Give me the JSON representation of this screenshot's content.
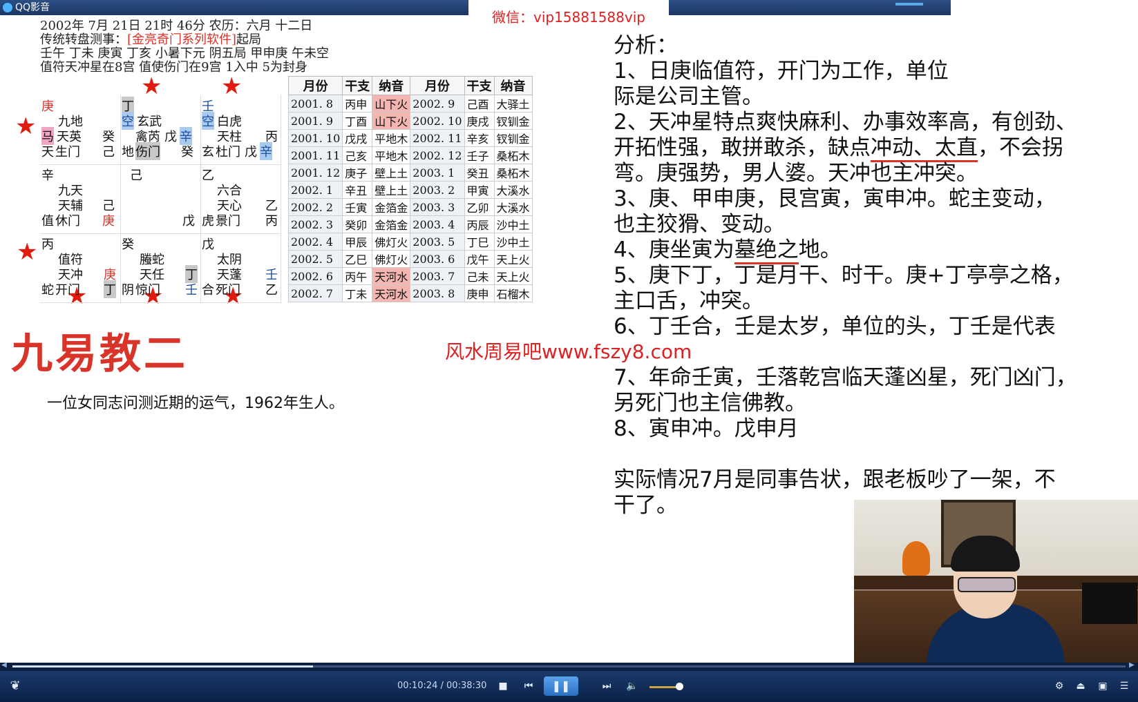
{
  "window": {
    "title": "QQ影音"
  },
  "wechat": "微信：vip15881588vip",
  "chart": {
    "line1": "2002年 7月 21日 21时 46分 农历：六月 十二日",
    "line2_a": "传统转盘测事：",
    "line2_b": "[金亮奇门系列软件]",
    "line2_c": "起局",
    "line3": "壬午 丁未 庚寅 丁亥 小暑下元 阴五局 甲申庚 午未空",
    "line4": "值符天冲星在8宫 值使伤门在9宫 1入中 5为封身",
    "cells": {
      "c1": [
        "庚",
        "九地",
        "马",
        "天英",
        "癸",
        "天",
        "生门",
        "己"
      ],
      "c2": [
        "丁",
        "空",
        "玄武",
        "禽芮",
        "戊",
        "辛",
        "地",
        "伤门",
        "癸"
      ],
      "c3": [
        "壬",
        "空",
        "白虎",
        "天柱",
        "丙",
        "玄",
        "杜门",
        "戊",
        "辛"
      ],
      "c4": [
        "辛",
        "九天",
        "天辅",
        "己",
        "值",
        "休门",
        "庚"
      ],
      "c5": [
        "己",
        "戊"
      ],
      "c6": [
        "乙",
        "六合",
        "天心",
        "乙",
        "虎",
        "景门",
        "丙"
      ],
      "c7": [
        "丙",
        "值符",
        "天冲",
        "庚",
        "蛇",
        "开门",
        "丁"
      ],
      "c8": [
        "癸",
        "螣蛇",
        "天任",
        "丁",
        "阴",
        "惊门",
        "壬"
      ],
      "c9": [
        "戊",
        "太阴",
        "天蓬",
        "壬",
        "合",
        "死门",
        "乙"
      ]
    },
    "table": {
      "headers": [
        "月份",
        "干支",
        "纳音",
        "月份",
        "干支",
        "纳音"
      ],
      "rows": [
        [
          "2001. 8",
          "丙申",
          "山下火",
          "2002. 9",
          "己酉",
          "大驿土"
        ],
        [
          "2001. 9",
          "丁酉",
          "山下火",
          "2002. 10",
          "庚戌",
          "钗钏金"
        ],
        [
          "2001. 10",
          "戊戌",
          "平地木",
          "2002. 11",
          "辛亥",
          "钗钏金"
        ],
        [
          "2001. 11",
          "己亥",
          "平地木",
          "2002. 12",
          "壬子",
          "桑柘木"
        ],
        [
          "2001. 12",
          "庚子",
          "壁上土",
          "2003. 1",
          "癸丑",
          "桑柘木"
        ],
        [
          "2002. 1",
          "辛丑",
          "壁上土",
          "2003. 2",
          "甲寅",
          "大溪水"
        ],
        [
          "2002. 2",
          "壬寅",
          "金箔金",
          "2003. 3",
          "乙卯",
          "大溪水"
        ],
        [
          "2002. 3",
          "癸卯",
          "金箔金",
          "2003. 4",
          "丙辰",
          "沙中土"
        ],
        [
          "2002. 4",
          "甲辰",
          "佛灯火",
          "2003. 5",
          "丁巳",
          "沙中土"
        ],
        [
          "2002. 5",
          "乙巳",
          "佛灯火",
          "2003. 6",
          "戊午",
          "天上火"
        ],
        [
          "2002. 6",
          "丙午",
          "天河水",
          "2003. 7",
          "己未",
          "天上火"
        ],
        [
          "2002. 7",
          "丁未",
          "天河水",
          "2003. 8",
          "庚申",
          "石榴木"
        ]
      ]
    }
  },
  "slide": {
    "title": "九易教二",
    "question": "一位女同志问测近期的运气，1962年生人。",
    "watermark": "风水周易吧www.fszy8.com"
  },
  "analysis": {
    "l0": "分析：",
    "l1": "1、日庚临值符，开门为工作，单位",
    "l2": "际是公司主管。",
    "l3": "2、天冲星特点爽快麻利、办事效率高，有创劲、",
    "l4a": "开拓性强，敢拼敢杀，缺点",
    "l4b": "冲动、太直",
    "l4c": "，不会拐",
    "l5": "弯。庚强势，男人婆。天冲也主冲突。",
    "l6": "3、庚、甲申庚，艮宫寅，寅申冲。蛇主变动，",
    "l7": "也主狡猾、变动。",
    "l8a": "4、庚坐寅为",
    "l8b": "墓绝之",
    "l8c": "地。",
    "l9": "5、庚下丁，丁是月干、时干。庚+丁亭亭之格，",
    "l10": "主口舌，冲突。",
    "l11": "6、丁壬合，壬是太岁，单位的头，丁壬是代表",
    "l12": "7、年命壬寅，壬落乾宫临天蓬凶星，死门凶门，",
    "l13": "另死门也主信佛教。",
    "l14": "8、寅申冲。戊申月",
    "l15": "实际情况7月是同事告状，跟老板吵了一架，不",
    "l16": "干了。"
  },
  "player": {
    "time": "00:10:24 / 00:38:30",
    "progress": 0.27,
    "volume": 0.8,
    "icons": [
      "footprint-icon",
      "stop-icon",
      "prev-icon",
      "pause-icon",
      "next-icon",
      "volume-icon",
      "wrench-icon",
      "eject-icon",
      "screen-icon",
      "list-icon"
    ]
  }
}
